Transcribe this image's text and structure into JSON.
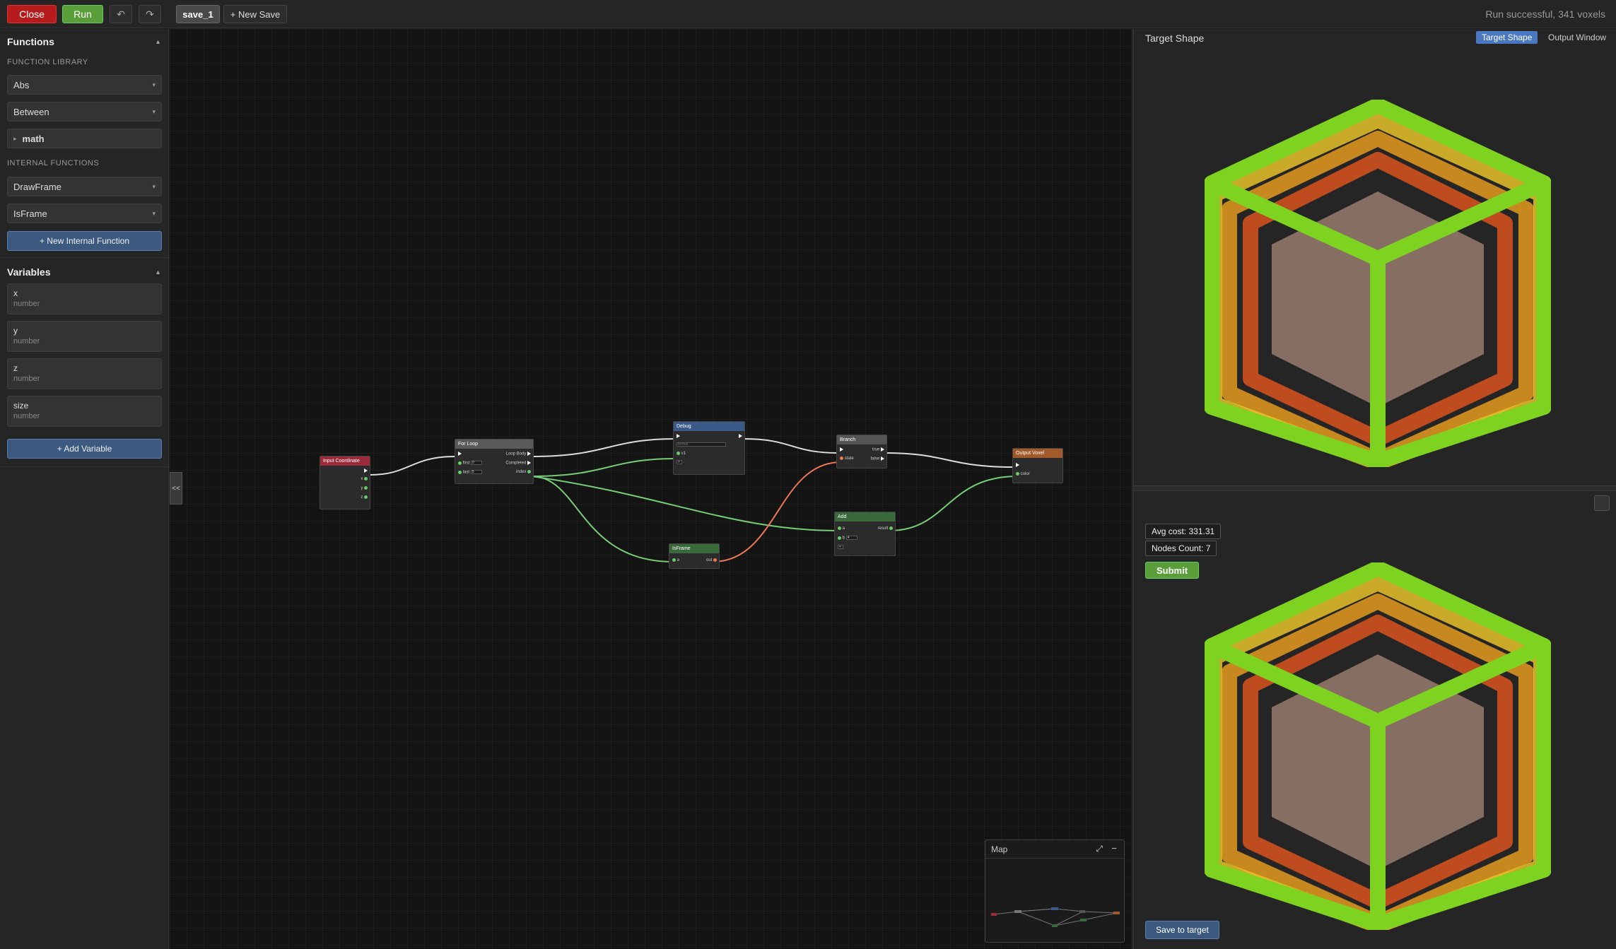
{
  "topbar": {
    "close_label": "Close",
    "run_label": "Run",
    "undo_icon": "↶",
    "redo_icon": "↷",
    "tab_active": "save_1",
    "tab_new": "+ New Save",
    "status": "Run successful, 341 voxels"
  },
  "sidebar": {
    "functions_title": "Functions",
    "library_label": "FUNCTION LIBRARY",
    "library_items": [
      "Abs",
      "Between"
    ],
    "folder_item": "math",
    "internal_label": "INTERNAL FUNCTIONS",
    "internal_items": [
      "DrawFrame",
      "IsFrame"
    ],
    "new_internal": "+ New Internal Function",
    "variables_title": "Variables",
    "variables": [
      {
        "name": "x",
        "type": "number"
      },
      {
        "name": "y",
        "type": "number"
      },
      {
        "name": "z",
        "type": "number"
      },
      {
        "name": "size",
        "type": "number"
      }
    ],
    "add_variable": "+ Add Variable",
    "collapse": "<<"
  },
  "nodes": {
    "input": {
      "title": "Input Coordinate",
      "outs": [
        "x",
        "y",
        "z"
      ]
    },
    "forloop": {
      "title": "For Loop",
      "first": "first",
      "first_val": "0",
      "last": "last",
      "last_val": "5",
      "loop_body": "Loop Body",
      "completed": "Completed",
      "index": "index"
    },
    "debug": {
      "title": "Debug",
      "input_ph": "format",
      "v1": "v1",
      "plus": "+"
    },
    "branch": {
      "title": "Branch",
      "state": "state",
      "true": "true",
      "false": "false"
    },
    "output": {
      "title": "Output Voxel",
      "color": "color"
    },
    "isframe": {
      "title": "IsFrame",
      "a": "a",
      "out": "out"
    },
    "add": {
      "title": "Add",
      "a": "a",
      "b": "b",
      "b_val": "4",
      "result": "result",
      "plus": "+"
    }
  },
  "minimap": {
    "title": "Map",
    "expand_icon": "⤢",
    "minimize_icon": "−"
  },
  "right_panel": {
    "title": "Target Shape",
    "tab_target": "Target Shape",
    "tab_output": "Output Window",
    "avg_cost": "Avg cost: 331.31",
    "nodes_count": "Nodes Count: 7",
    "submit": "Submit",
    "save_target": "Save to target"
  },
  "colors": {
    "frame_outer": "#7ed321",
    "frame_2": "#e6c229",
    "frame_3": "#e39a1e",
    "frame_4": "#d9531e",
    "core": "#e8b8a0",
    "close": "#b71c1c",
    "run": "#5a9e3a"
  }
}
